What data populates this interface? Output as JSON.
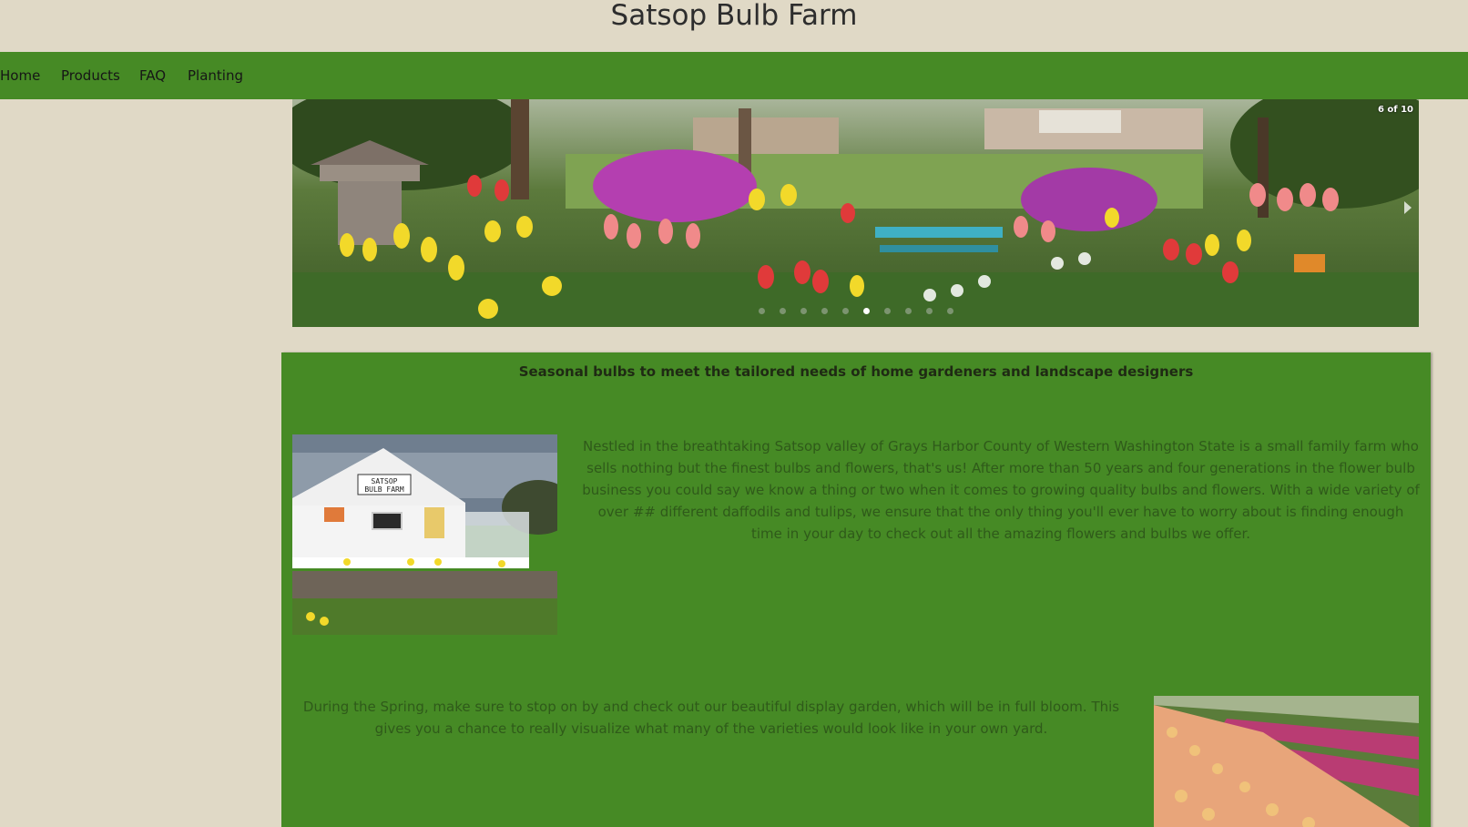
{
  "site": {
    "title": "Satsop Bulb Farm"
  },
  "nav": {
    "items": [
      {
        "label": "Home"
      },
      {
        "label": "Products"
      },
      {
        "label": "FAQ"
      },
      {
        "label": "Planting"
      }
    ]
  },
  "slideshow": {
    "counter": "6 of 10",
    "total": 10,
    "active_index": 6,
    "image": "garden-tulips-daffodils-photo"
  },
  "content": {
    "tagline": "Seasonal bulbs to meet the tailored needs of home gardeners and landscape designers",
    "intro": "Nestled in the breathtaking Satsop valley of Grays Harbor County of Western Washington State is a small family farm who sells nothing but the finest bulbs and flowers, that's us! After more than 50 years and four generations in the flower bulb business you could say we know a thing or two when it comes to growing quality bulbs and flowers. With a wide variety of over ## different daffodils and tulips, we ensure that the only thing you'll ever have to worry about is finding enough time in your day to check out all the amazing flowers and bulbs we offer.",
    "spring": "During the Spring, make sure to stop on by and check out our beautiful display garden, which will be in full bloom. This gives you a chance to really visualize what many of the varieties would look like in your own yard.",
    "shop_sign": "SATSOP BULB FARM",
    "shop_sign_line1": "SATSOP",
    "shop_sign_line2": "BULB FARM"
  },
  "colors": {
    "background": "#e0d9c6",
    "nav_green": "#468a25",
    "body_text": "#2f5a1a"
  }
}
